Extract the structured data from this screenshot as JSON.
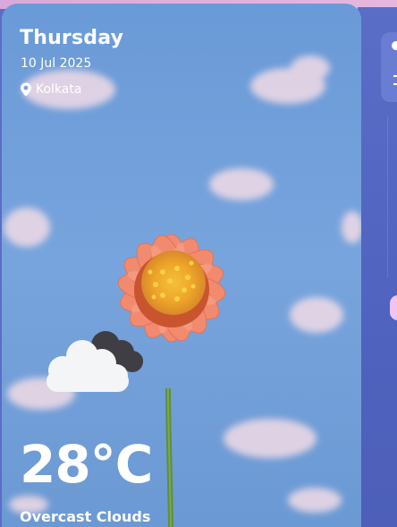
{
  "weather": {
    "day": "Thursday",
    "date": "10 Jul 2025",
    "location": "Kolkata",
    "temperature": "28°C",
    "condition": "Overcast Clouds",
    "condition_icon": "overcast-clouds-icon",
    "location_icon": "map-pin-icon"
  },
  "colors": {
    "sky": "#7aa3dc",
    "page_background": "#5b6ec4",
    "flower_petal": "#f28a6f",
    "flower_center": "#f2b12a",
    "text": "#ffffff"
  }
}
